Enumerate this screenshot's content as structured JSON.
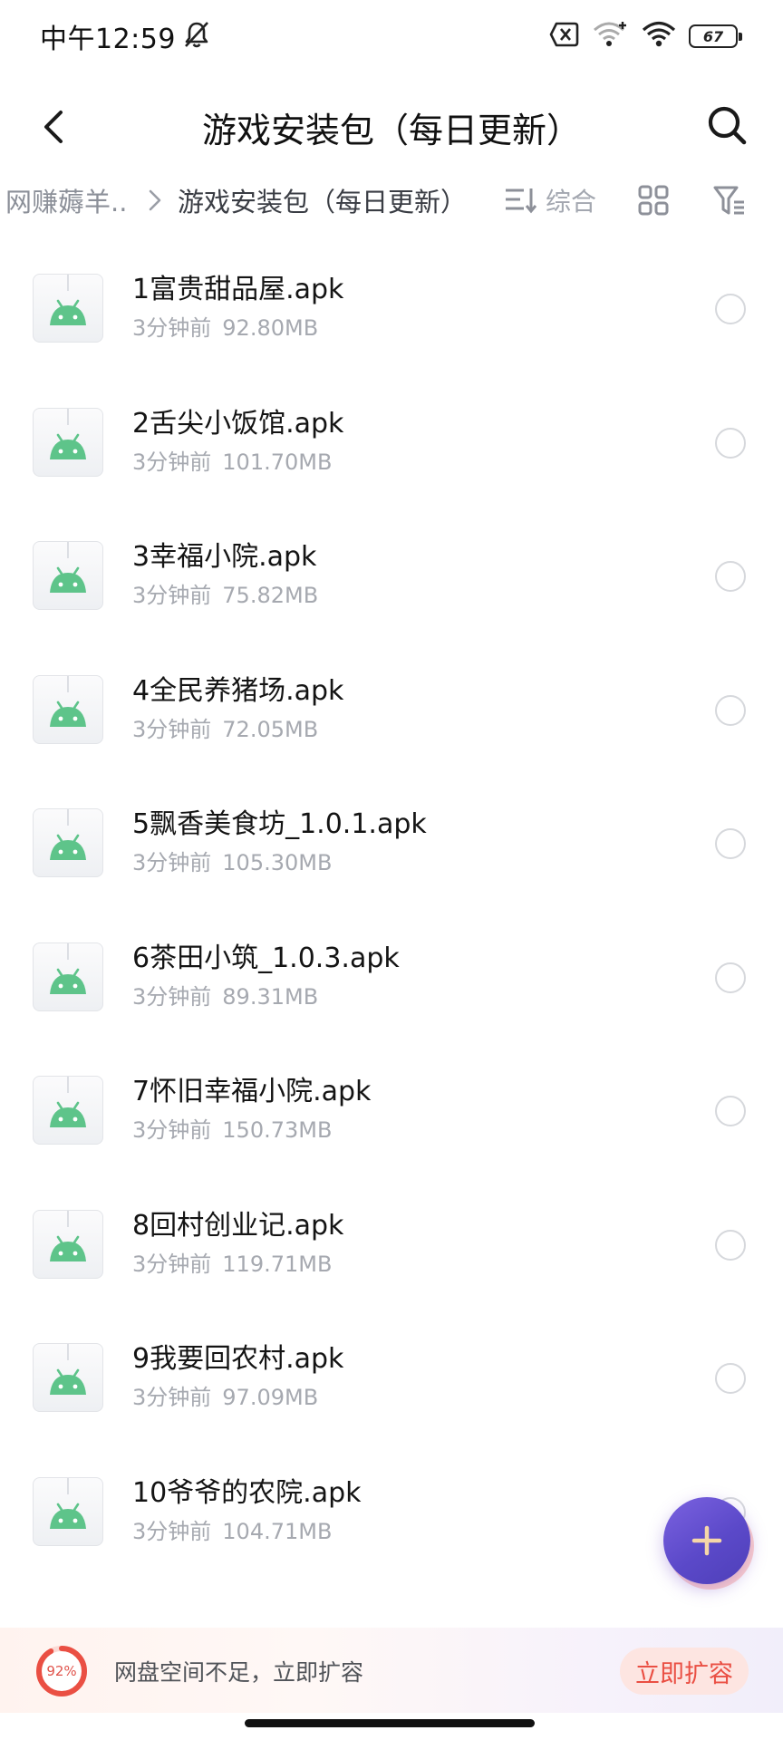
{
  "status_bar": {
    "time": "中午12:59",
    "battery": "67"
  },
  "header": {
    "title": "游戏安装包（每日更新）"
  },
  "breadcrumb": {
    "parent": "网赚薅羊..",
    "current": "游戏安装包（每日更新）"
  },
  "toolbar": {
    "sort_label": "综合"
  },
  "files": [
    {
      "name": "1富贵甜品屋.apk",
      "time": "3分钟前",
      "size": "92.80MB"
    },
    {
      "name": "2舌尖小饭馆.apk",
      "time": "3分钟前",
      "size": "101.70MB"
    },
    {
      "name": "3幸福小院.apk",
      "time": "3分钟前",
      "size": "75.82MB"
    },
    {
      "name": "4全民养猪场.apk",
      "time": "3分钟前",
      "size": "72.05MB"
    },
    {
      "name": "5飘香美食坊_1.0.1.apk",
      "time": "3分钟前",
      "size": "105.30MB"
    },
    {
      "name": "6茶田小筑_1.0.3.apk",
      "time": "3分钟前",
      "size": "89.31MB"
    },
    {
      "name": "7怀旧幸福小院.apk",
      "time": "3分钟前",
      "size": "150.73MB"
    },
    {
      "name": "8回村创业记.apk",
      "time": "3分钟前",
      "size": "119.71MB"
    },
    {
      "name": "9我要回农村.apk",
      "time": "3分钟前",
      "size": "97.09MB"
    },
    {
      "name": "10爷爷的农院.apk",
      "time": "3分钟前",
      "size": "104.71MB"
    }
  ],
  "storage": {
    "usage_label": "92%",
    "usage_fraction": 0.92,
    "message": "网盘空间不足，立即扩容",
    "action_label": "立即扩容"
  },
  "colors": {
    "android_green": "#5ec48a",
    "fab_purple": "#5b49c9",
    "warning_red": "#ea4f43"
  }
}
